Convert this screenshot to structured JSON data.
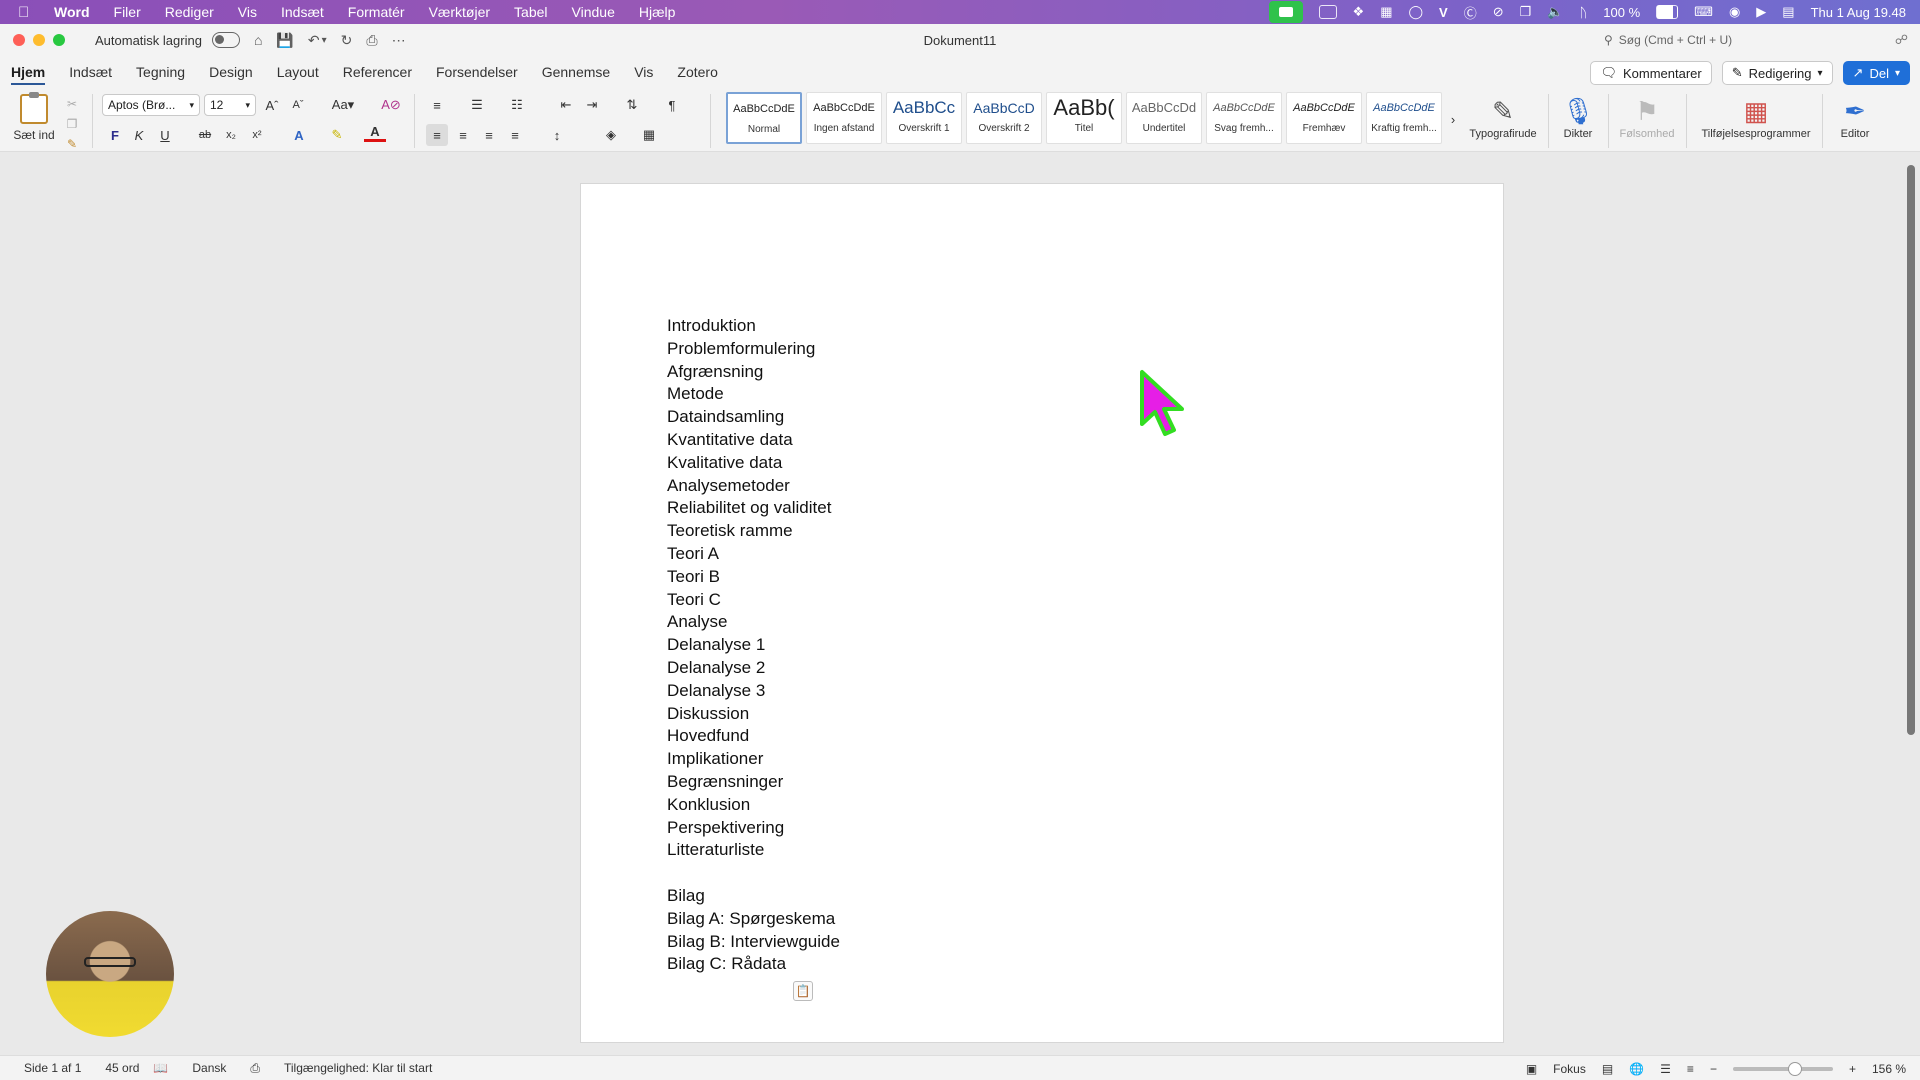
{
  "menubar": {
    "app_name": "Word",
    "items": [
      "Filer",
      "Rediger",
      "Vis",
      "Indsæt",
      "Formatér",
      "Værktøjer",
      "Tabel",
      "Vindue",
      "Hjælp"
    ],
    "battery": "100 %",
    "clock": "Thu 1 Aug  19.48"
  },
  "titlebar": {
    "autosave_label": "Automatisk lagring",
    "doc_title": "Dokument11",
    "search_placeholder": "Søg (Cmd + Ctrl + U)"
  },
  "ribbon_tabs": [
    "Hjem",
    "Indsæt",
    "Tegning",
    "Design",
    "Layout",
    "Referencer",
    "Forsendelser",
    "Gennemse",
    "Vis",
    "Zotero"
  ],
  "actions": {
    "comments": "Kommentarer",
    "editing": "Redigering",
    "share": "Del"
  },
  "ribbon": {
    "paste_label": "Sæt ind",
    "font_name": "Aptos (Brø...",
    "font_size": "12",
    "styles": [
      {
        "sample": "AaBbCcDdE",
        "name": "Normal"
      },
      {
        "sample": "AaBbCcDdE",
        "name": "Ingen afstand"
      },
      {
        "sample": "AaBbCc",
        "name": "Overskrift 1"
      },
      {
        "sample": "AaBbCcD",
        "name": "Overskrift 2"
      },
      {
        "sample": "AaBb(",
        "name": "Titel"
      },
      {
        "sample": "AaBbCcDd",
        "name": "Undertitel"
      },
      {
        "sample": "AaBbCcDdE",
        "name": "Svag fremh..."
      },
      {
        "sample": "AaBbCcDdE",
        "name": "Fremhæv"
      },
      {
        "sample": "AaBbCcDdE",
        "name": "Kraftig fremh..."
      }
    ],
    "tools": {
      "typography": "Typografirude",
      "dictate": "Dikter",
      "sensitivity": "Følsomhed",
      "addins": "Tilføjelsesprogrammer",
      "editor": "Editor"
    }
  },
  "document": {
    "lines": [
      "Introduktion",
      "Problemformulering",
      "Afgrænsning",
      "Metode",
      "Dataindsamling",
      "Kvantitative data",
      "Kvalitative data",
      "Analysemetoder",
      "Reliabilitet og validitet",
      "Teoretisk ramme",
      "Teori A",
      "Teori B",
      "Teori C",
      "Analyse",
      "Delanalyse 1",
      "Delanalyse 2",
      "Delanalyse 3",
      "Diskussion",
      "Hovedfund",
      "Implikationer",
      "Begrænsninger",
      "Konklusion",
      "Perspektivering",
      "Litteraturliste",
      "",
      "Bilag",
      "Bilag A: Spørgeskema",
      "Bilag B: Interviewguide",
      "Bilag C: Rådata"
    ]
  },
  "statusbar": {
    "page": "Side 1 af 1",
    "words": "45 ord",
    "language": "Dansk",
    "accessibility": "Tilgængelighed: Klar til start",
    "focus": "Fokus",
    "zoom": "156 %"
  },
  "colors": {
    "accent": "#1f6fd8",
    "cursor_fill": "#e61ee6",
    "cursor_outline": "#33dd22"
  }
}
